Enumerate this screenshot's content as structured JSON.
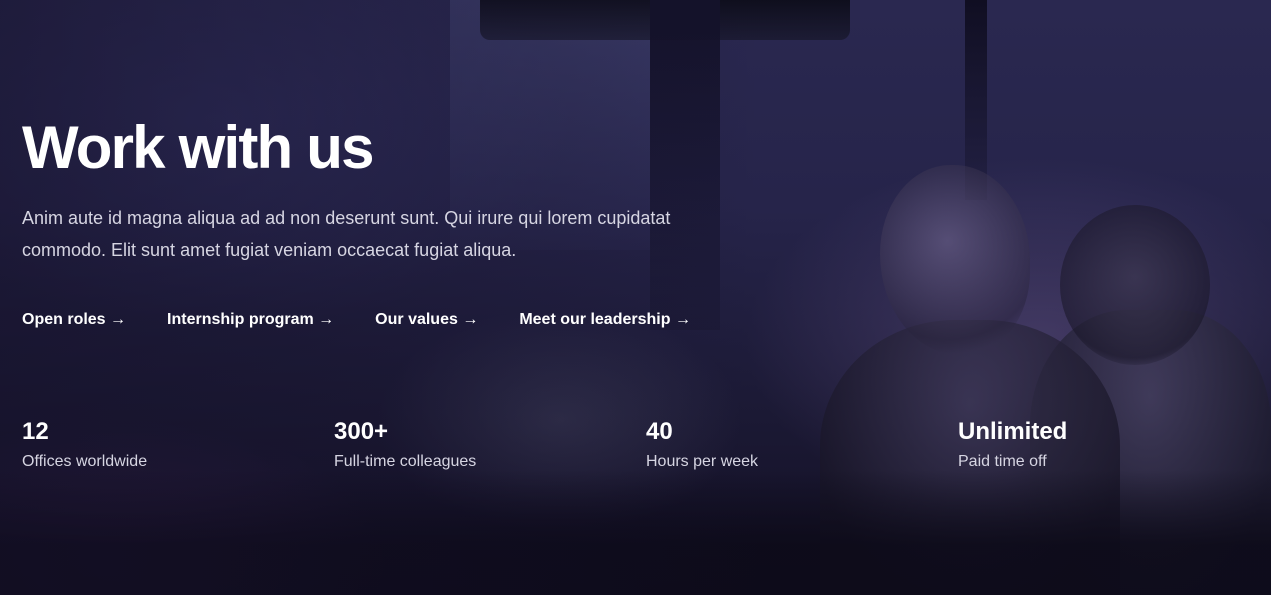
{
  "hero": {
    "title": "Work with us",
    "description": "Anim aute id magna aliqua ad ad non deserunt sunt. Qui irure qui lorem cupidatat commodo. Elit sunt amet fugiat veniam occaecat fugiat aliqua.",
    "links": [
      {
        "label": "Open roles",
        "arrow": "→"
      },
      {
        "label": "Internship program",
        "arrow": "→"
      },
      {
        "label": "Our values",
        "arrow": "→"
      },
      {
        "label": "Meet our leadership",
        "arrow": "→"
      }
    ],
    "stats": [
      {
        "value": "12",
        "label": "Offices worldwide"
      },
      {
        "value": "300+",
        "label": "Full-time colleagues"
      },
      {
        "value": "40",
        "label": "Hours per week"
      },
      {
        "value": "Unlimited",
        "label": "Paid time off"
      }
    ]
  },
  "colors": {
    "text": "#ffffff",
    "muted_text": "#d6d5e2",
    "background": "#1b1934",
    "accent_tint": "#3a2a5a"
  }
}
